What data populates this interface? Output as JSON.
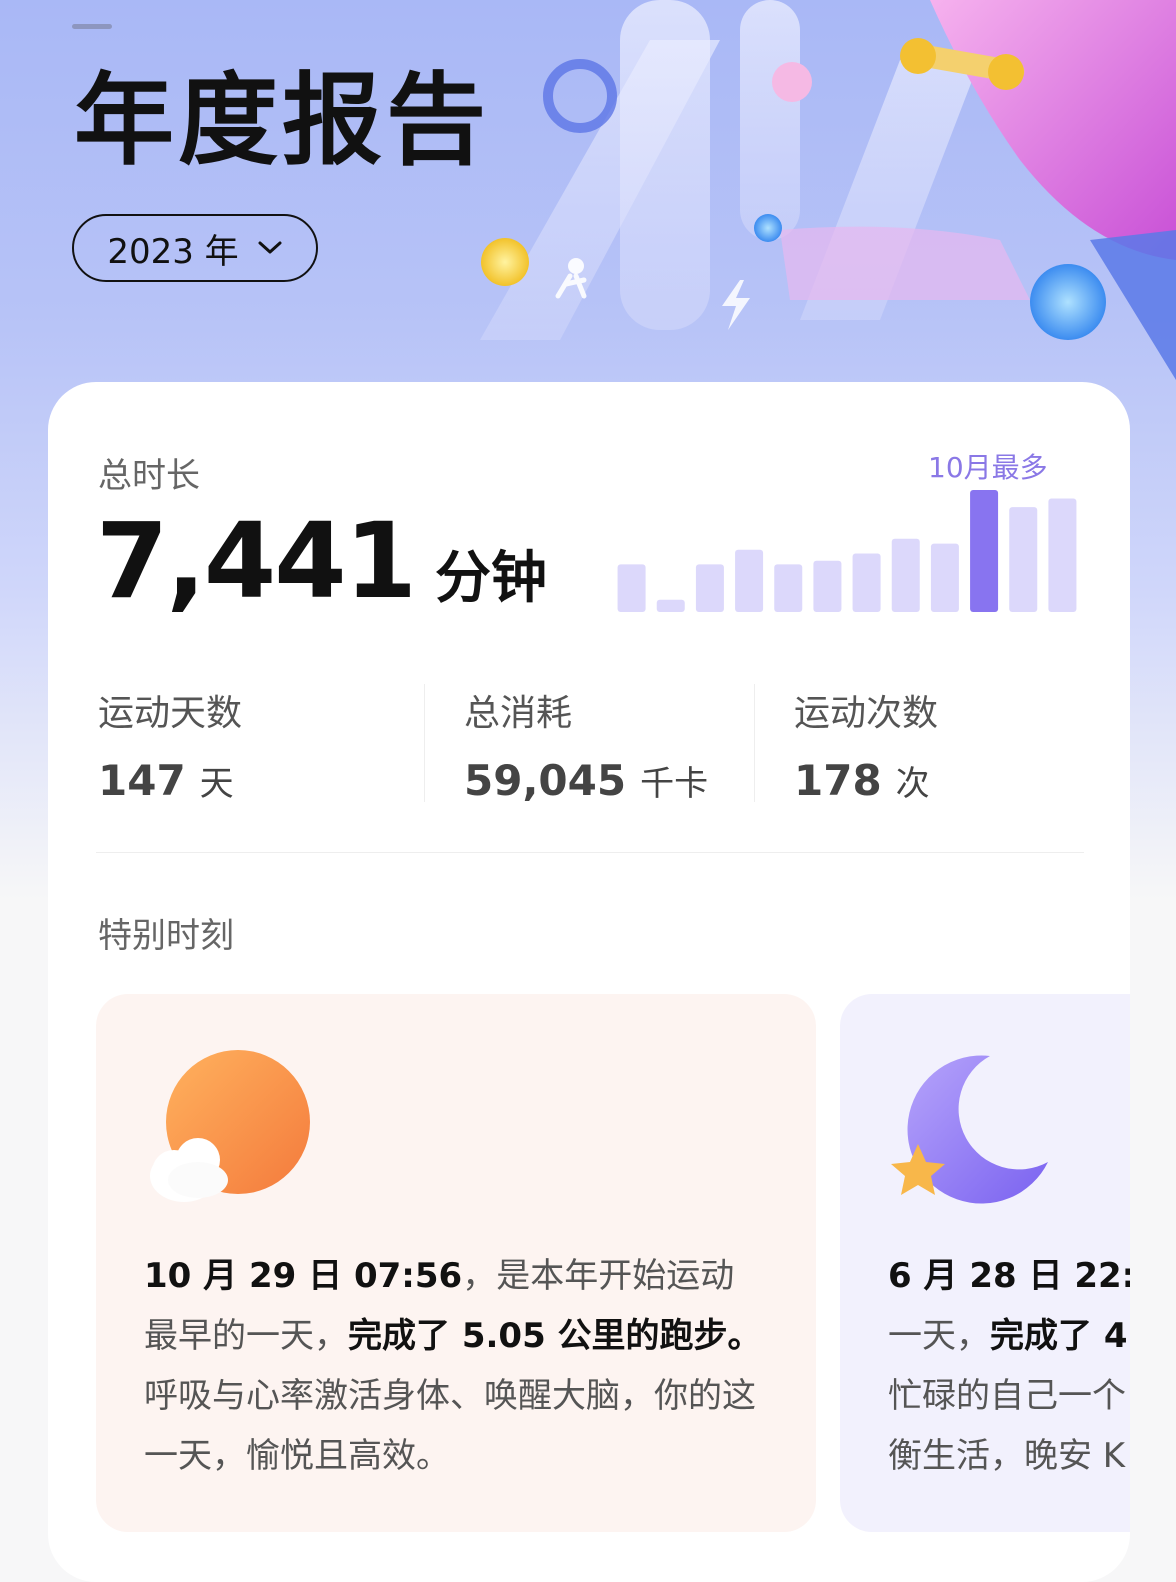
{
  "header": {
    "title": "年度报告",
    "year_selector": {
      "label": "2023 年",
      "chevron": "chevron-down-icon"
    }
  },
  "summary": {
    "total_label": "总时长",
    "total_value": "7,441",
    "total_unit": "分钟",
    "peak_label": "10月最多",
    "monthly_chart": {
      "type": "bar",
      "months": [
        1,
        2,
        3,
        4,
        5,
        6,
        7,
        8,
        9,
        10,
        11,
        12
      ],
      "relative_values": [
        0.39,
        0.1,
        0.39,
        0.51,
        0.39,
        0.42,
        0.48,
        0.6,
        0.56,
        1.0,
        0.86,
        0.93
      ],
      "highlight_month": 10,
      "colors": {
        "normal": "#dcd8fb",
        "highlight": "#8874f0"
      }
    }
  },
  "stats": [
    {
      "label": "运动天数",
      "value": "147",
      "unit": "天"
    },
    {
      "label": "总消耗",
      "value": "59,045",
      "unit": "千卡"
    },
    {
      "label": "运动次数",
      "value": "178",
      "unit": "次"
    }
  ],
  "special": {
    "label": "特别时刻",
    "moments": [
      {
        "icon": "sun-cloud-icon",
        "time_bold": "10 月 29 日 07:56",
        "text_a": "，是本年开始运动最早的一天，",
        "bold_b": "完成了 5.05 公里的跑步。",
        "text_c": "呼吸与心率激活身体、唤醒大脑，你的这一天，愉悦且高效。"
      },
      {
        "icon": "moon-star-icon",
        "line1_bold": "6 月 28 日 22:",
        "line2_a": "一天，",
        "line2_bold": "完成了 4",
        "line3": "忙碌的自己一个",
        "line4": "衡生活，晚安 K"
      }
    ]
  },
  "colors": {
    "accent": "#8874f0",
    "title": "#111111",
    "sun": "#f79a4e",
    "moon": "#9a86f6"
  }
}
